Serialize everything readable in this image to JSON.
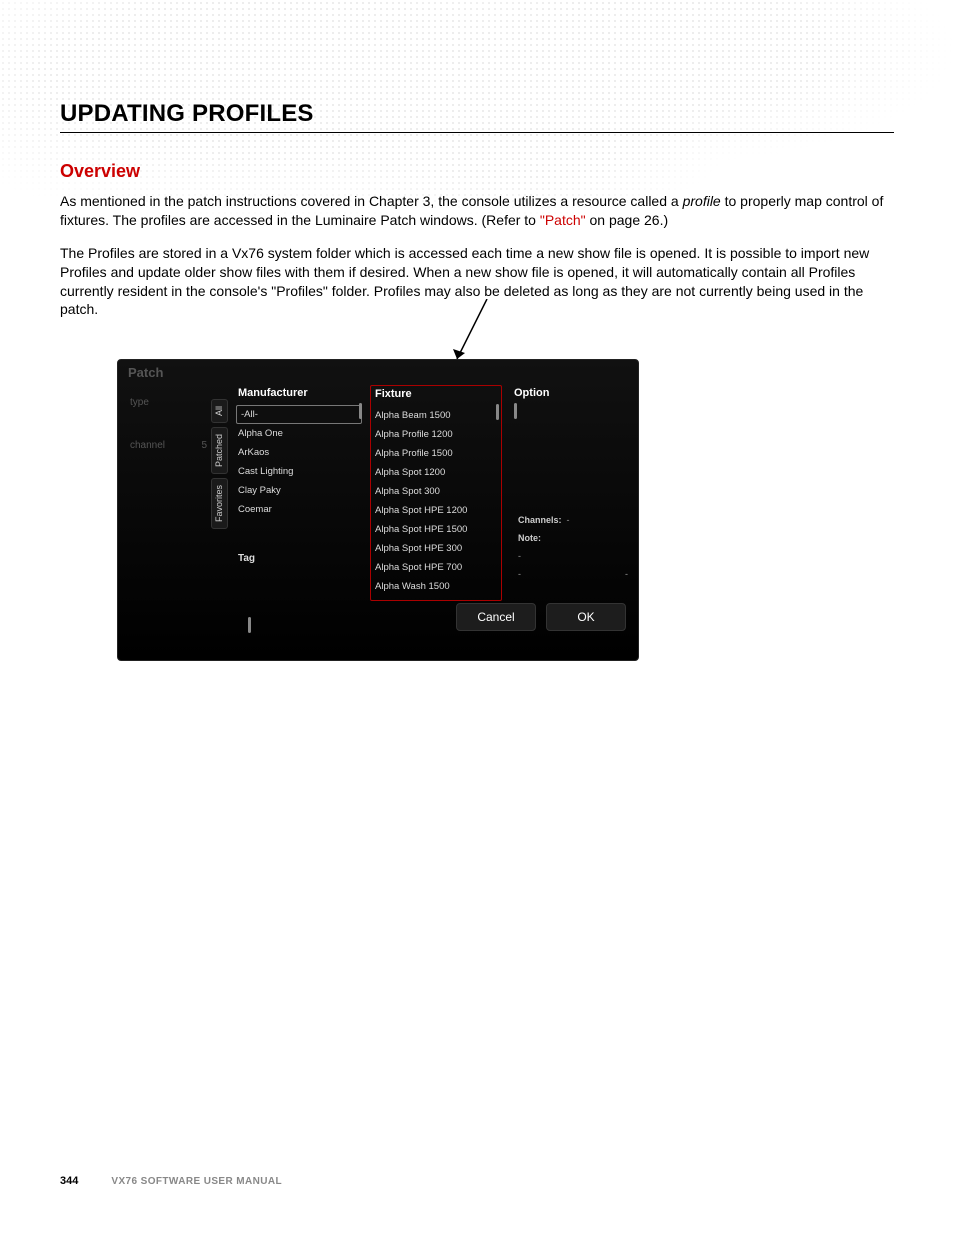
{
  "heading": "UPDATING PROFILES",
  "subheading": "Overview",
  "para1_a": "As mentioned in the patch instructions covered in Chapter 3, the console utilizes a resource called a ",
  "para1_profile": "profile",
  "para1_b": " to properly map control of fixtures. The profiles are accessed in the Luminaire Patch windows. (Refer to ",
  "para1_link": "\"Patch\"",
  "para1_c": " on page 26.)",
  "para2": "The Profiles are stored in a Vx76 system folder which is accessed each time a new show file is opened. It is possible to import new Profiles and update older show files with them if desired. When a new show file is opened, it will automatically contain all Profiles currently resident in the console's \"Profiles\" folder. Profiles may also be deleted as long as they are not currently being used in the patch.",
  "panel": {
    "title": "Patch",
    "left": {
      "type_lbl": "type",
      "channel_lbl": "channel",
      "channel_val": "5"
    },
    "tabs": [
      "All",
      "Patched",
      "Favorites"
    ],
    "tag_label": "Tag",
    "cols": {
      "manufacturer": {
        "header": "Manufacturer",
        "items": [
          "-All-",
          "Alpha One",
          "ArKaos",
          "Cast Lighting",
          "Clay Paky",
          "Coemar"
        ]
      },
      "fixture": {
        "header": "Fixture",
        "items": [
          "Alpha Beam 1500",
          "Alpha Profile 1200",
          "Alpha Profile 1500",
          "Alpha Spot 1200",
          "Alpha Spot 300",
          "Alpha Spot HPE 1200",
          "Alpha Spot HPE 1500",
          "Alpha Spot HPE 300",
          "Alpha Spot HPE 700",
          "Alpha Wash 1500"
        ]
      },
      "option": {
        "header": "Option"
      }
    },
    "info": {
      "channels_lbl": "Channels:",
      "channels_val": "-",
      "note_lbl": "Note:",
      "dash": "-"
    },
    "buttons": {
      "cancel": "Cancel",
      "ok": "OK"
    }
  },
  "footer": {
    "page": "344",
    "manual": "VX76 SOFTWARE USER MANUAL"
  }
}
